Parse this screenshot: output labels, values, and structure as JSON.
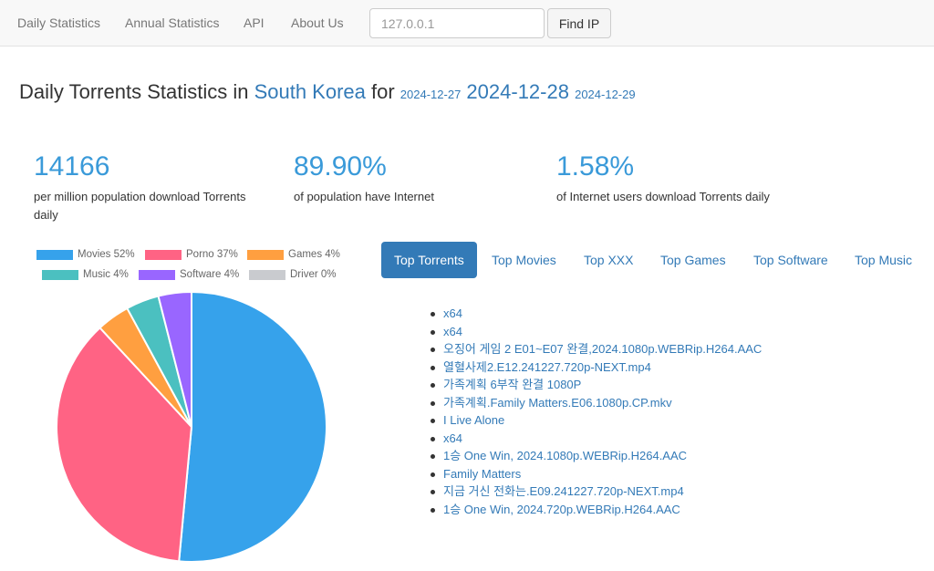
{
  "nav": {
    "items": [
      "Daily Statistics",
      "Annual Statistics",
      "API",
      "About Us"
    ],
    "ip_placeholder": "127.0.0.1",
    "find_label": "Find IP"
  },
  "title": {
    "prefix": "Daily Torrents Statistics in ",
    "country": "South Korea",
    "for": " for ",
    "prev_date": "2024-12-27",
    "date": "2024-12-28",
    "next_date": "2024-12-29"
  },
  "stats": [
    {
      "value": "14166",
      "desc": "per million population download Torrents daily"
    },
    {
      "value": "89.90%",
      "desc": "of population have Internet"
    },
    {
      "value": "1.58%",
      "desc": "of Internet users download Torrents daily"
    }
  ],
  "chart_data": {
    "type": "pie",
    "categories": [
      "Movies",
      "Porno",
      "Games",
      "Music",
      "Software",
      "Driver"
    ],
    "values": [
      52,
      37,
      4,
      4,
      4,
      0
    ],
    "legend": [
      "Movies 52%",
      "Porno 37%",
      "Games 4%",
      "Music 4%",
      "Software 4%",
      "Driver 0%"
    ],
    "colors": [
      "#36a2eb",
      "#ff6384",
      "#ff9f40",
      "#4bc0c0",
      "#9966ff",
      "#c9cbcf"
    ],
    "legend_position": "top"
  },
  "tabs": [
    "Top Torrents",
    "Top Movies",
    "Top XXX",
    "Top Games",
    "Top Software",
    "Top Music"
  ],
  "torrents": [
    "x64",
    "x64",
    "오징어 게임 2 E01~E07 완결,2024.1080p.WEBRip.H264.AAC",
    "열혈사제2.E12.241227.720p-NEXT.mp4",
    "가족계획 6부작 완결 1080P",
    "가족계획.Family Matters.E06.1080p.CP.mkv",
    "I Live Alone",
    "x64",
    "1승 One Win, 2024.1080p.WEBRip.H264.AAC",
    "Family Matters",
    "지금 거신 전화는.E09.241227.720p-NEXT.mp4",
    "1승 One Win, 2024.720p.WEBRip.H264.AAC"
  ]
}
